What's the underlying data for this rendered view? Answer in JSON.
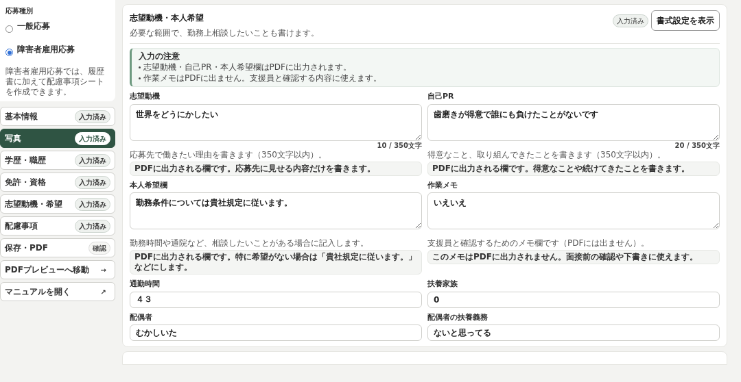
{
  "application_type": {
    "title": "応募種別",
    "options": [
      {
        "label": "一般応募",
        "selected": false
      },
      {
        "label": "障害者雇用応募",
        "selected": true
      }
    ],
    "description": "障害者雇用応募では、履歴書に加えて配慮事項シートを作成できます。"
  },
  "nav": [
    {
      "kind": "status",
      "label": "基本情報",
      "badge": "入力済み",
      "selected": false
    },
    {
      "kind": "status",
      "label": "写真",
      "badge": "入力済み",
      "selected": true
    },
    {
      "kind": "status",
      "label": "学歴・職歴",
      "badge": "入力済み",
      "selected": false
    },
    {
      "kind": "status",
      "label": "免許・資格",
      "badge": "入力済み",
      "selected": false
    },
    {
      "kind": "status",
      "label": "志望動機・希望",
      "badge": "入力済み",
      "selected": false
    },
    {
      "kind": "status",
      "label": "配慮事項",
      "badge": "入力済み",
      "selected": false
    },
    {
      "kind": "check",
      "label": "保存・PDF",
      "badge": "確認",
      "selected": false
    },
    {
      "kind": "link",
      "label": "PDFプレビューへ移動",
      "arrow": "→",
      "selected": false
    },
    {
      "kind": "link",
      "label": "マニュアルを開く",
      "arrow": "↗",
      "selected": false
    }
  ],
  "section": {
    "title": "志望動機・本人希望",
    "subtitle": "必要な範囲で、勤務上相談したいことも書けます。",
    "badge": "入力済み",
    "format_button": "書式設定を表示",
    "notice": {
      "title": "入力の注意",
      "items": [
        "志望動機・自己PR・本人希望欄はPDFに出力されます。",
        "作業メモはPDFに出ません。支援員と確認する内容に使えます。"
      ]
    },
    "fields": [
      {
        "kind": "textarea",
        "label": "志望動機",
        "value": "世界をどうにかしたい",
        "count": "10 / 350文字",
        "hint": "応募先で働きたい理由を書きます（350文字以内）。",
        "note": "PDFに出力される欄です。応募先に見せる内容だけを書きます。"
      },
      {
        "kind": "textarea",
        "label": "自己PR",
        "value": "歯磨きが得意で誰にも負けたことがないです",
        "count": "20 / 350文字",
        "hint": "得意なこと、取り組んできたことを書きます（350文字以内）。",
        "note": "PDFに出力される欄です。得意なことや続けてきたことを書きます。"
      },
      {
        "kind": "textarea",
        "label": "本人希望欄",
        "value": "勤務条件については貴社規定に従います。",
        "hint": "勤務時間や通院など、相談したいことがある場合に記入します。",
        "note": "PDFに出力される欄です。特に希望がない場合は「貴社規定に従います。」などにします。"
      },
      {
        "kind": "textarea",
        "label": "作業メモ",
        "value": "いえいえ",
        "hint": "支援員と確認するためのメモ欄です（PDFには出ません）。",
        "note": "このメモはPDFに出力されません。面接前の確認や下書きに使えます。"
      },
      {
        "kind": "input",
        "label": "通勤時間",
        "value": "４３"
      },
      {
        "kind": "input",
        "label": "扶養家族",
        "value": "0"
      },
      {
        "kind": "input",
        "label": "配偶者",
        "value": "むかしいた"
      },
      {
        "kind": "input",
        "label": "配偶者の扶養義務",
        "value": "ないと思ってる"
      }
    ]
  }
}
